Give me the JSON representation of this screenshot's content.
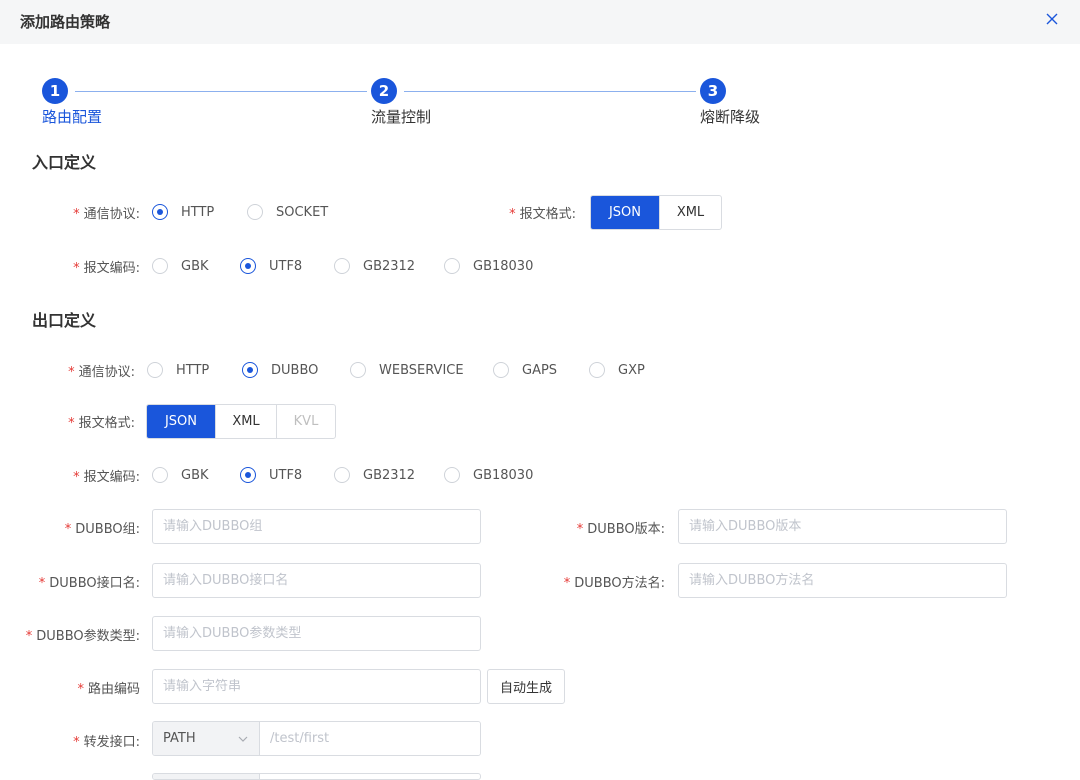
{
  "dialog": {
    "title": "添加路由策略"
  },
  "steps": [
    {
      "number": "1",
      "label": "路由配置"
    },
    {
      "number": "2",
      "label": "流量控制"
    },
    {
      "number": "3",
      "label": "熔断降级"
    }
  ],
  "entry": {
    "title": "入口定义",
    "protocol": {
      "label": "通信协议:",
      "options": [
        "HTTP",
        "SOCKET"
      ],
      "selected": "HTTP"
    },
    "format": {
      "label": "报文格式:",
      "options": [
        "JSON",
        "XML"
      ],
      "selected": "JSON"
    },
    "encoding": {
      "label": "报文编码:",
      "options": [
        "GBK",
        "UTF8",
        "GB2312",
        "GB18030"
      ],
      "selected": "UTF8"
    }
  },
  "exit": {
    "title": "出口定义",
    "protocol": {
      "label": "通信协议:",
      "options": [
        "HTTP",
        "DUBBO",
        "WEBSERVICE",
        "GAPS",
        "GXP"
      ],
      "selected": "DUBBO"
    },
    "format": {
      "label": "报文格式:",
      "options": [
        "JSON",
        "XML",
        "KVL"
      ],
      "selected": "JSON",
      "disabled": "KVL"
    },
    "encoding": {
      "label": "报文编码:",
      "options": [
        "GBK",
        "UTF8",
        "GB2312",
        "GB18030"
      ],
      "selected": "UTF8"
    },
    "dubbo_group": {
      "label": "DUBBO组:",
      "placeholder": "请输入DUBBO组"
    },
    "dubbo_version": {
      "label": "DUBBO版本:",
      "placeholder": "请输入DUBBO版本"
    },
    "dubbo_interface": {
      "label": "DUBBO接口名:",
      "placeholder": "请输入DUBBO接口名"
    },
    "dubbo_method": {
      "label": "DUBBO方法名:",
      "placeholder": "请输入DUBBO方法名"
    },
    "dubbo_param_type": {
      "label": "DUBBO参数类型:",
      "placeholder": "请输入DUBBO参数类型"
    },
    "route_code": {
      "label": "路由编码",
      "placeholder": "请输入字符串",
      "button": "自动生成"
    },
    "forward": {
      "label": "转发接口:",
      "select_value": "PATH",
      "placeholder": "/test/first"
    }
  },
  "colors": {
    "primary": "#1a56db",
    "required": "#e53935"
  }
}
